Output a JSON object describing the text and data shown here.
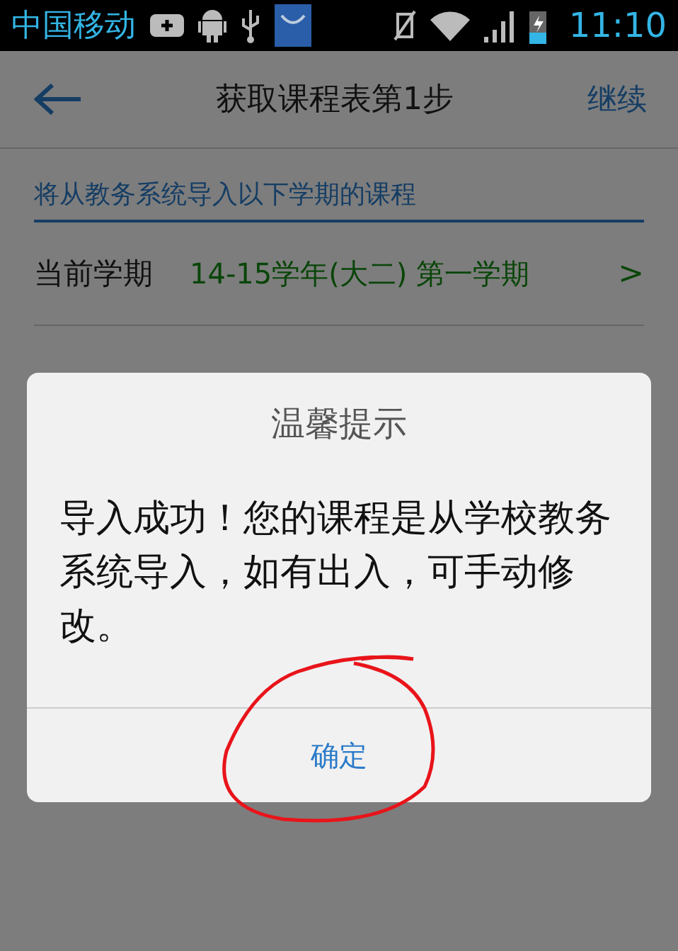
{
  "status_bar": {
    "carrier": "中国移动",
    "time": "11:10"
  },
  "header": {
    "title": "获取课程表第1步",
    "action": "继续"
  },
  "hint": "将从教务系统导入以下学期的课程",
  "term": {
    "label": "当前学期",
    "value": "14-15学年(大二) 第一学期",
    "chevron": ">"
  },
  "dialog": {
    "title": "温馨提示",
    "message": "导入成功！您的课程是从学校教务系统导入，如有出入，可手动修改。",
    "button": "确定"
  }
}
